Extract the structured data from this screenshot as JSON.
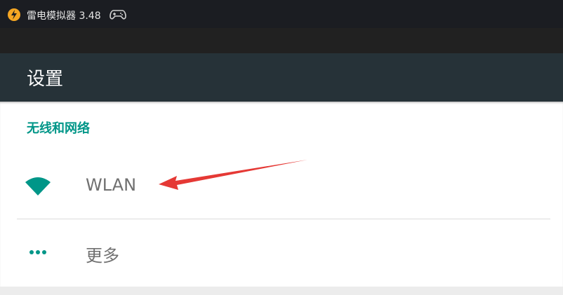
{
  "window": {
    "title": "雷电模拟器 3.48",
    "logo_icon": "leidian-logo-icon",
    "gamepad_icon": "gamepad-icon"
  },
  "settings": {
    "title": "设置",
    "section_header": "无线和网络",
    "items": [
      {
        "label": "WLAN",
        "icon": "wifi-icon"
      },
      {
        "label": "更多",
        "icon": "more-dots-icon"
      }
    ]
  },
  "colors": {
    "accent": "#009688",
    "appbar": "#263238",
    "arrow": "#e53935"
  }
}
